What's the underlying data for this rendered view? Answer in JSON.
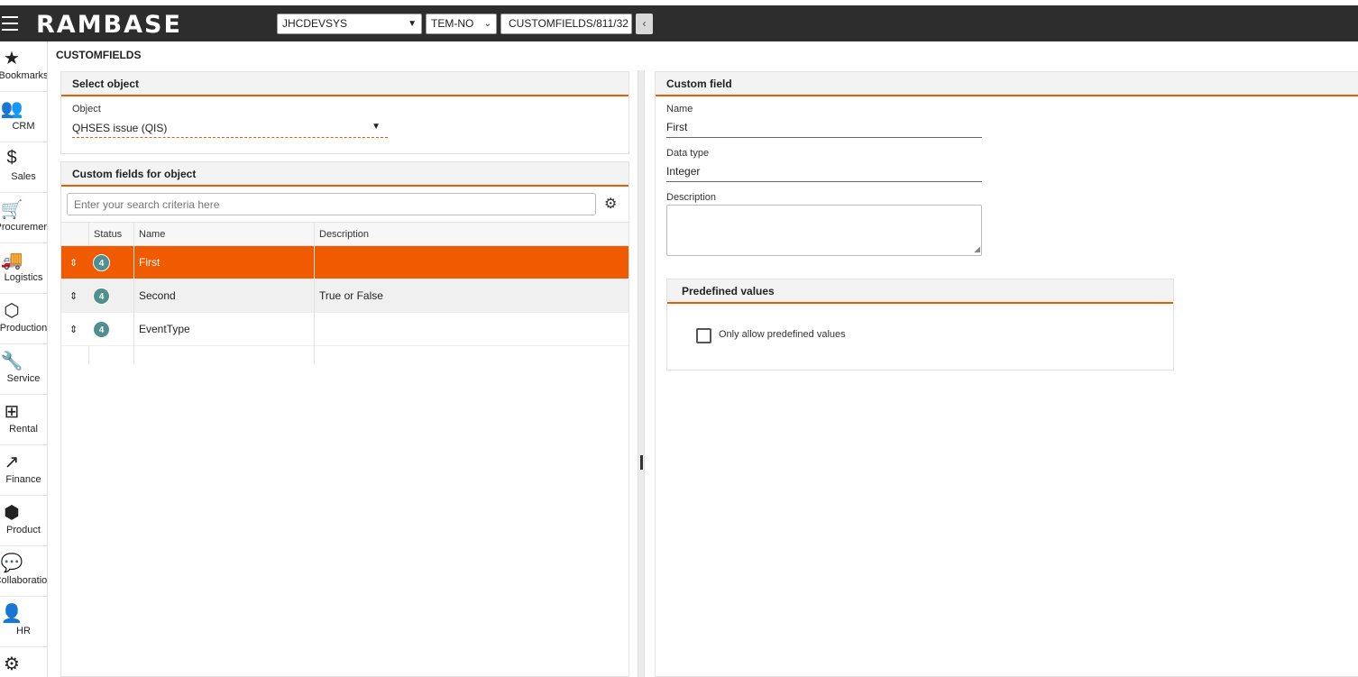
{
  "app": {
    "logo_main": "RAMBASE"
  },
  "topbar": {
    "system_select": "JHCDEVSYS",
    "company_select": "TEM-NO",
    "path_field": "CUSTOMFIELDS/811/32",
    "collapse_glyph": "‹"
  },
  "sidebar": {
    "items": [
      {
        "label": "Bookmarks",
        "icon": "star-icon",
        "glyph": "★"
      },
      {
        "label": "CRM",
        "icon": "people-icon",
        "glyph": "👥"
      },
      {
        "label": "Sales",
        "icon": "money-bag-icon",
        "glyph": "$"
      },
      {
        "label": "Procurement",
        "icon": "cart-icon",
        "glyph": "🛒"
      },
      {
        "label": "Logistics",
        "icon": "truck-icon",
        "glyph": "🚚"
      },
      {
        "label": "Production",
        "icon": "boxes-icon",
        "glyph": "⬡"
      },
      {
        "label": "Service",
        "icon": "wrench-icon",
        "glyph": "🔧"
      },
      {
        "label": "Rental",
        "icon": "rental-icon",
        "glyph": "⊞"
      },
      {
        "label": "Finance",
        "icon": "chart-line-icon",
        "glyph": "↗"
      },
      {
        "label": "Product",
        "icon": "cube-icon",
        "glyph": "⬢"
      },
      {
        "label": "Collaboration",
        "icon": "chat-icon",
        "glyph": "💬"
      },
      {
        "label": "HR",
        "icon": "person-icon",
        "glyph": "👤"
      },
      {
        "label": "",
        "icon": "gear-icon",
        "glyph": "⚙"
      }
    ]
  },
  "page": {
    "title": "CUSTOMFIELDS"
  },
  "select_object": {
    "header": "Select object",
    "object_label": "Object",
    "object_value": "QHSES issue (QIS)"
  },
  "custom_fields": {
    "header": "Custom fields for object",
    "search_placeholder": "Enter your search criteria here",
    "columns": [
      "Status",
      "Name",
      "Description"
    ],
    "rows": [
      {
        "status": "4",
        "name": "First",
        "description": ""
      },
      {
        "status": "4",
        "name": "Second",
        "description": "True or False"
      },
      {
        "status": "4",
        "name": "EventType",
        "description": ""
      }
    ]
  },
  "custom_field": {
    "header": "Custom field",
    "name_label": "Name",
    "name_value": "First",
    "datatype_label": "Data type",
    "datatype_value": "Integer",
    "description_label": "Description",
    "description_value": ""
  },
  "predefined": {
    "header": "Predefined values",
    "checkbox_label": "Only allow predefined values",
    "checked": false
  },
  "colors": {
    "accent": "#f05a00",
    "topbar": "#2d2d2d",
    "badge": "#4f8f8f"
  }
}
